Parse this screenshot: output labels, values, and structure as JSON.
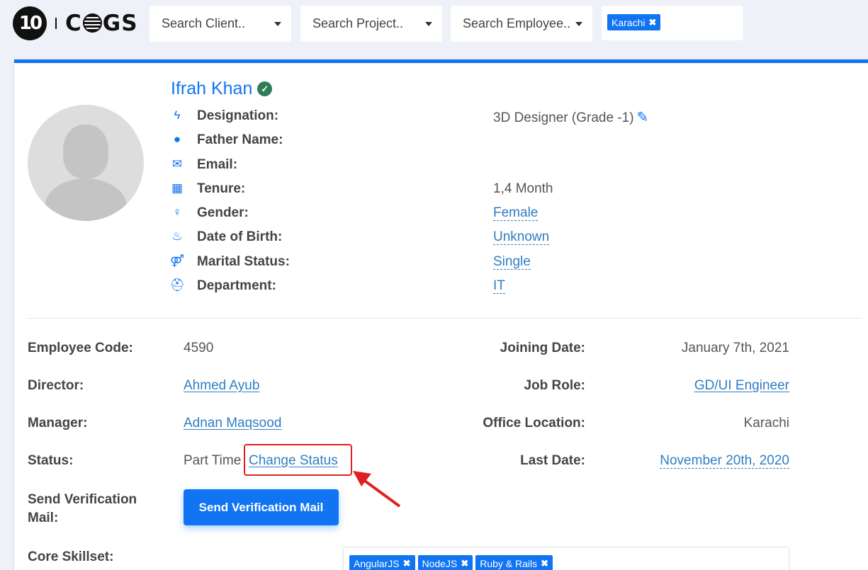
{
  "logo": {
    "mark": "10",
    "word_a": "C",
    "word_b": "GS"
  },
  "filters": {
    "client_placeholder": "Search Client..",
    "project_placeholder": "Search Project..",
    "employee_placeholder": "Search Employee..",
    "location_tags": [
      "Karachi"
    ]
  },
  "profile": {
    "name": "Ifrah Khan",
    "verified_mark": "✓",
    "rows": [
      {
        "icon": "bolt-icon",
        "glyph": "ϟ",
        "label": "Designation:",
        "value": "3D Designer (Grade -1)",
        "style": "plain",
        "editable": true
      },
      {
        "icon": "user-icon",
        "glyph": "●",
        "label": "Father Name:",
        "value": "",
        "style": "plain"
      },
      {
        "icon": "envelope-icon",
        "glyph": "✉",
        "label": "Email:",
        "value": "",
        "style": "plain"
      },
      {
        "icon": "calendar-icon",
        "glyph": "▦",
        "label": "Tenure:",
        "value": "1,4 Month",
        "style": "plain"
      },
      {
        "icon": "female-icon",
        "glyph": "♀",
        "label": "Gender:",
        "value": "Female",
        "style": "dashed"
      },
      {
        "icon": "birthday-cake-icon",
        "glyph": "♨",
        "label": "Date of Birth:",
        "value": "Unknown",
        "style": "dashed"
      },
      {
        "icon": "gender-symbol-icon",
        "glyph": "⚤",
        "label": "Marital Status:",
        "value": "Single",
        "style": "dashed"
      },
      {
        "icon": "user-secret-icon",
        "glyph": "⛑",
        "label": "Department:",
        "value": "IT",
        "style": "dashed"
      }
    ]
  },
  "details": {
    "employee_code_label": "Employee Code:",
    "employee_code": "4590",
    "director_label": "Director:",
    "director": "Ahmed Ayub",
    "manager_label": "Manager:",
    "manager": "Adnan Maqsood",
    "status_label": "Status:",
    "status": "Part Time",
    "change_status": "Change Status",
    "verification_label_1": "Send Verification",
    "verification_label_2": "Mail:",
    "verification_button": "Send Verification Mail",
    "core_skillset_label": "Core Skillset:",
    "joining_date_label": "Joining Date:",
    "joining_date": "January 7th, 2021",
    "job_role_label": "Job Role:",
    "job_role": "GD/UI Engineer",
    "office_location_label": "Office Location:",
    "office_location": "Karachi",
    "last_date_label": "Last Date:",
    "last_date": "November 20th, 2020"
  },
  "skills": [
    "AngularJS",
    "NodeJS",
    "Ruby & Rails"
  ],
  "colors": {
    "accent": "#1174f2",
    "link": "#2f7ec2",
    "annotation": "#e02020",
    "verified": "#2e7d55"
  }
}
